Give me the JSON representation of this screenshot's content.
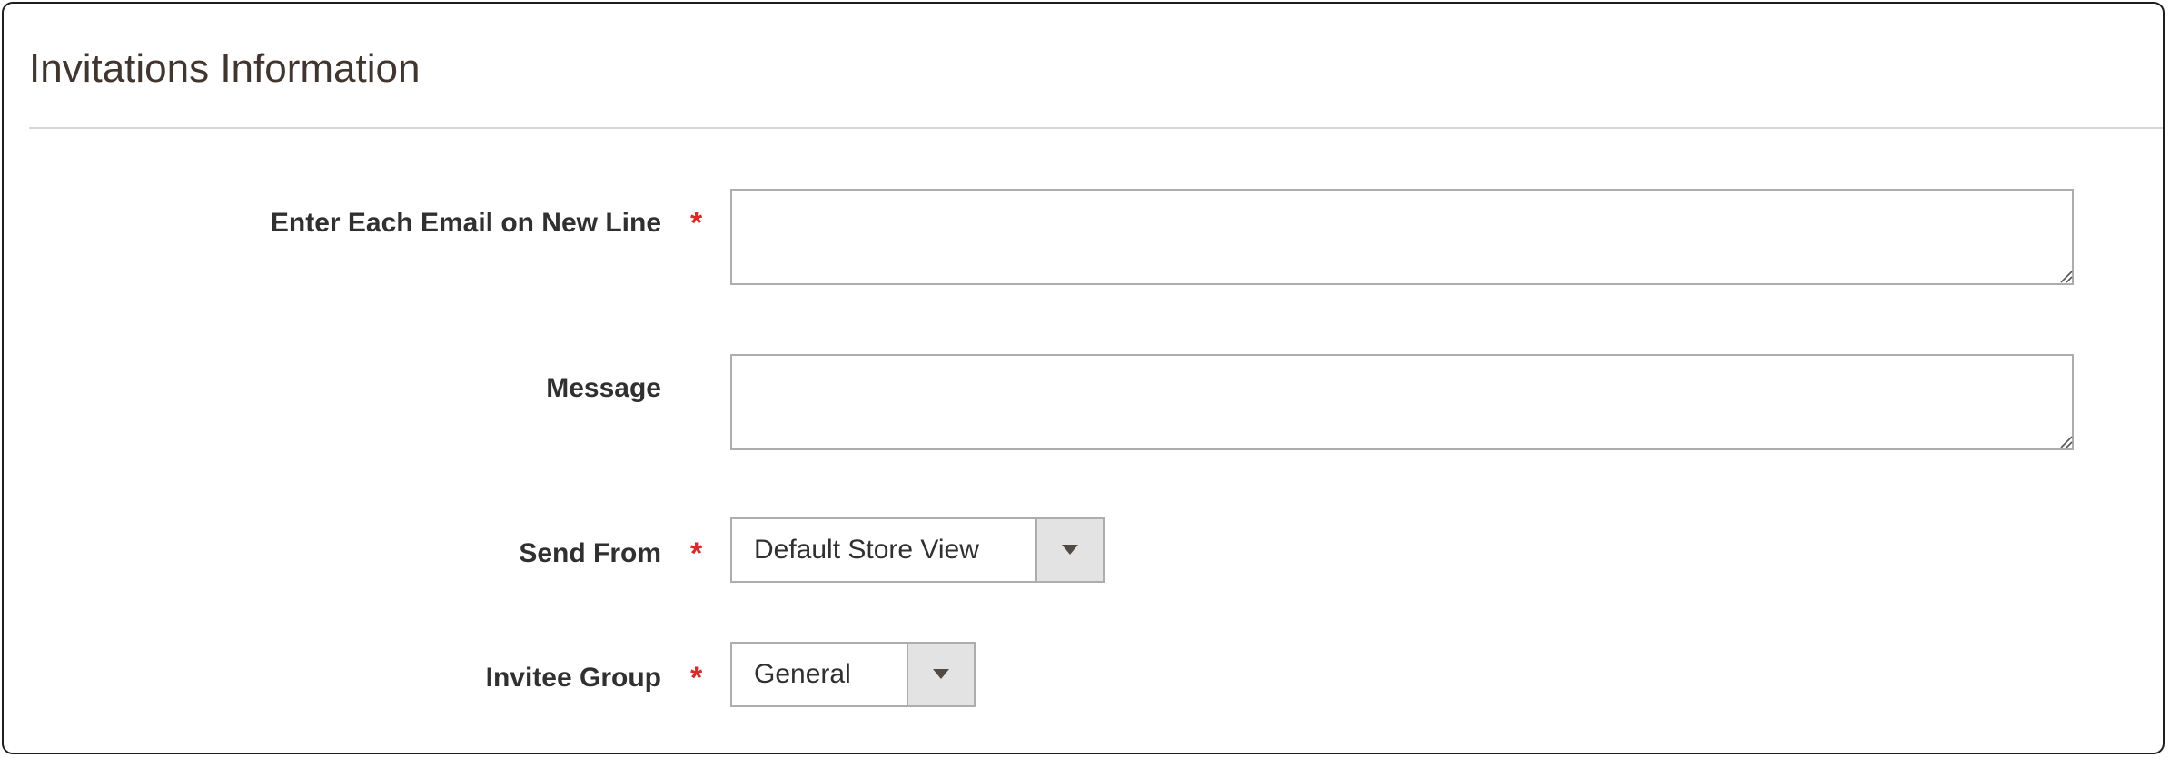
{
  "section": {
    "title": "Invitations Information"
  },
  "fields": {
    "emails": {
      "label": "Enter Each Email on New Line",
      "required_mark": "*",
      "value": ""
    },
    "message": {
      "label": "Message",
      "value": ""
    },
    "send_from": {
      "label": "Send From",
      "required_mark": "*",
      "selected": "Default Store View"
    },
    "invitee_group": {
      "label": "Invitee Group",
      "required_mark": "*",
      "selected": "General"
    }
  },
  "colors": {
    "required": "#e22626",
    "border": "#adadad",
    "arrow_bg": "#e3e3e3",
    "title": "#41362f"
  },
  "icons": {
    "dropdown": "triangle-down",
    "resize": "resize-grip"
  }
}
